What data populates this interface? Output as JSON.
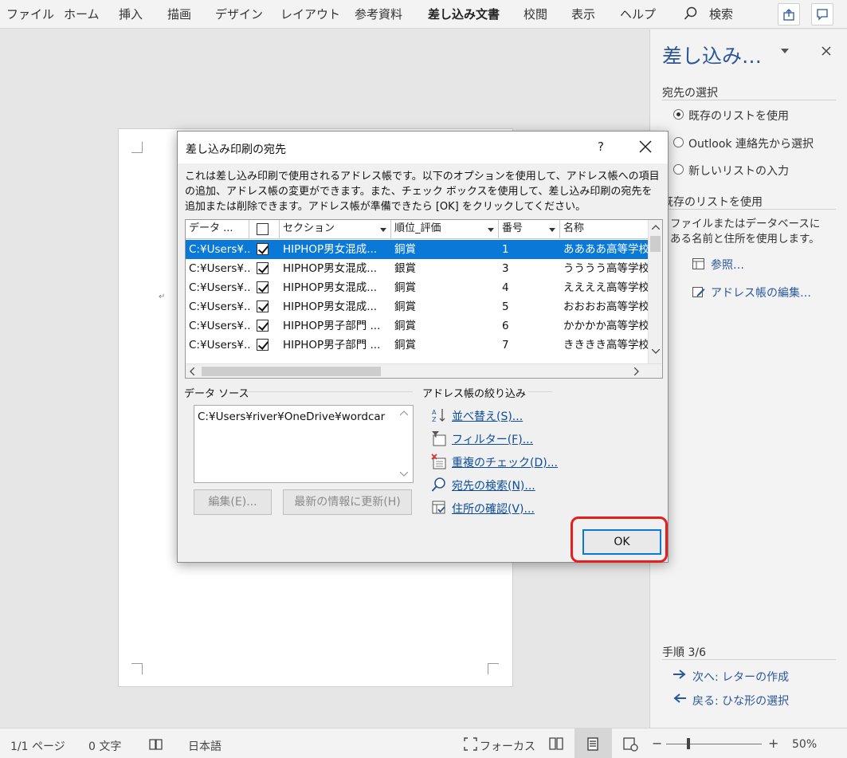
{
  "ribbon": {
    "tabs": [
      "ファイル",
      "ホーム",
      "挿入",
      "描画",
      "デザイン",
      "レイアウト",
      "参考資料",
      "差し込み文書",
      "校閲",
      "表示",
      "ヘルプ"
    ],
    "active_tab": "差し込み文書",
    "search_label": "検索"
  },
  "pane": {
    "title": "差し込み…",
    "recipient_section": "宛先の選択",
    "options": [
      {
        "label": "既存のリストを使用",
        "selected": true
      },
      {
        "label": "Outlook 連絡先から選択",
        "selected": false
      },
      {
        "label": "新しいリストの入力",
        "selected": false
      }
    ],
    "existing_section": "既存のリストを使用",
    "existing_desc": "ファイルまたはデータベースにある名前と住所を使用します。",
    "browse_link": "参照…",
    "edit_link": "アドレス帳の編集…",
    "step": "手順 3/6",
    "next_link": "次へ: レターの作成",
    "back_link": "戻る: ひな形の選択"
  },
  "status": {
    "page": "1/1 ページ",
    "words": "0 文字",
    "language": "日本語",
    "focus": "フォーカス",
    "zoom": "50%"
  },
  "dialog": {
    "title": "差し込み印刷の宛先",
    "help": "?",
    "description": "これは差し込み印刷で使用されるアドレス帳です。以下のオプションを使用して、アドレス帳への項目の追加、アドレス帳の変更ができます。また、チェック ボックスを使用して、差し込み印刷の宛先を追加または削除できます。アドレス帳が準備できたら [OK] をクリックしてください。",
    "columns": [
      "データ ...",
      "",
      "セクション",
      "順位_評価",
      "番号",
      "名称"
    ],
    "rows": [
      {
        "source": "C:¥Users¥...",
        "checked": true,
        "section": "HIPHOP男女混成...",
        "rank": "銅賞",
        "number": "1",
        "name": "ああああ高等学校"
      },
      {
        "source": "C:¥Users¥...",
        "checked": true,
        "section": "HIPHOP男女混成...",
        "rank": "銀賞",
        "number": "3",
        "name": "うううう高等学校"
      },
      {
        "source": "C:¥Users¥...",
        "checked": true,
        "section": "HIPHOP男女混成...",
        "rank": "銅賞",
        "number": "4",
        "name": "ええええ高等学校"
      },
      {
        "source": "C:¥Users¥...",
        "checked": true,
        "section": "HIPHOP男女混成...",
        "rank": "銅賞",
        "number": "5",
        "name": "おおおお高等学校"
      },
      {
        "source": "C:¥Users¥...",
        "checked": true,
        "section": "HIPHOP男子部門 ...",
        "rank": "銅賞",
        "number": "6",
        "name": "かかかか高等学校"
      },
      {
        "source": "C:¥Users¥...",
        "checked": true,
        "section": "HIPHOP男子部門 ...",
        "rank": "銅賞",
        "number": "7",
        "name": "きききき高等学校"
      }
    ],
    "datasource_label": "データ ソース",
    "datasource_value": "C:¥Users¥river¥OneDrive¥wordcar",
    "edit_button": "編集(E)...",
    "refresh_button": "最新の情報に更新(H)",
    "filter_label": "アドレス帳の絞り込み",
    "filter_links": [
      "並べ替え(S)...",
      "フィルター(F)...",
      "重複のチェック(D)...",
      "宛先の検索(N)...",
      "住所の確認(V)..."
    ],
    "ok_button": "OK"
  },
  "colors": {
    "accent": "#2b579a",
    "selection": "#0a78d7",
    "highlight": "#e61e1e"
  }
}
